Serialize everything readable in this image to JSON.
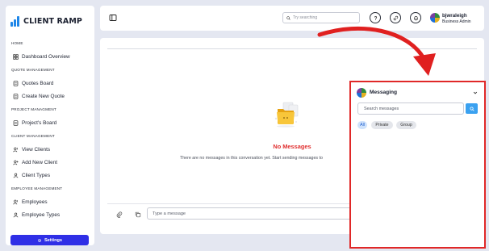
{
  "brand": {
    "logo_text": "CLIENT RAMP",
    "accent": "#2f2fe6",
    "highlight": "#e02828"
  },
  "sidebar": {
    "sections": [
      {
        "title": "HOME",
        "items": [
          {
            "label": "Dashboard Overview",
            "icon": "grid-icon"
          }
        ]
      },
      {
        "title": "QUOTE MANAGEMENT",
        "items": [
          {
            "label": "Quotes Board",
            "icon": "document-icon"
          },
          {
            "label": "Create New Quote",
            "icon": "document-icon"
          }
        ]
      },
      {
        "title": "PROJECT MANAGMENT",
        "items": [
          {
            "label": "Project's Board",
            "icon": "document-icon"
          }
        ]
      },
      {
        "title": "CLIENT MANAGEMENT",
        "items": [
          {
            "label": "View Clients",
            "icon": "users-icon"
          },
          {
            "label": "Add New Client",
            "icon": "user-plus-icon"
          },
          {
            "label": "Client Types",
            "icon": "user-icon"
          }
        ]
      },
      {
        "title": "EMPLOYEE MANAGEMENT",
        "items": [
          {
            "label": "Employees",
            "icon": "users-icon"
          },
          {
            "label": "Employee Types",
            "icon": "user-icon"
          }
        ]
      }
    ],
    "settings_label": "Settings"
  },
  "header": {
    "search_placeholder": "Try searching",
    "user": {
      "name": "bjwraleigh",
      "role": "Business Admin"
    }
  },
  "main": {
    "empty_title": "No Messages",
    "empty_text": "There are no messages in this conversation yet. Start sending messages to",
    "compose_placeholder": "Type a message"
  },
  "messaging_popup": {
    "title": "Messaging",
    "search_placeholder": "Search messages",
    "filters": [
      "All",
      "Private",
      "Group"
    ],
    "active_filter": "All"
  }
}
